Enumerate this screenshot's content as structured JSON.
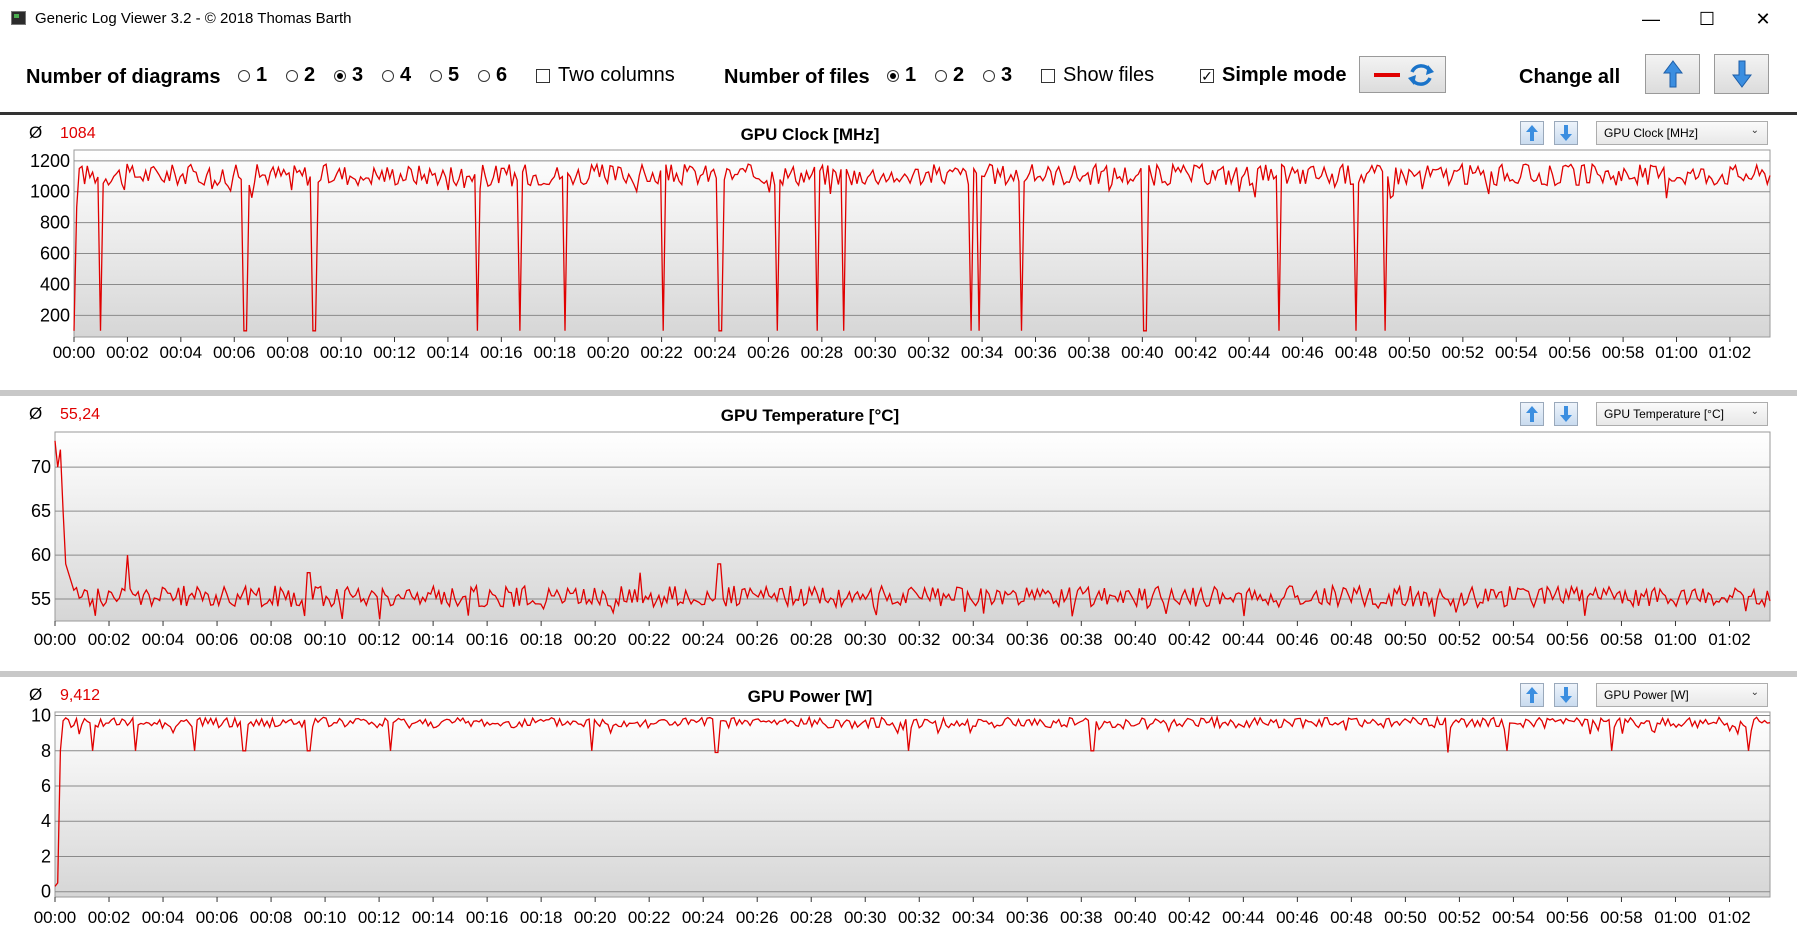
{
  "window": {
    "title": "Generic Log Viewer 3.2 - © 2018 Thomas Barth",
    "minimize": "—",
    "maximize": "☐",
    "close": "✕"
  },
  "toolbar": {
    "diagrams_label": "Number of diagrams",
    "diagram_options": [
      "1",
      "2",
      "3",
      "4",
      "5",
      "6"
    ],
    "diagrams_selected": "3",
    "two_columns_label": "Two columns",
    "two_columns_checked": false,
    "files_label": "Number of files",
    "file_options": [
      "1",
      "2",
      "3"
    ],
    "files_selected": "1",
    "show_files_label": "Show files",
    "show_files_checked": false,
    "simple_mode_label": "Simple mode",
    "simple_mode_checked": true,
    "change_all_label": "Change all",
    "line_color": "#e00000"
  },
  "charts": [
    {
      "avg_symbol": "Ø",
      "avg_value": "1084",
      "title": "GPU Clock [MHz]",
      "dropdown": "GPU Clock [MHz]",
      "ylim": [
        60,
        1270
      ],
      "yticks": [
        200,
        400,
        600,
        800,
        1000,
        1200
      ],
      "baseline": 1110,
      "noise": 70,
      "start_values": [
        100,
        900,
        1150
      ],
      "dips": [
        [
          1.0,
          100
        ],
        [
          6.4,
          100
        ],
        [
          9.0,
          100
        ],
        [
          15.1,
          100
        ],
        [
          16.7,
          100
        ],
        [
          18.4,
          100
        ],
        [
          22.1,
          100
        ],
        [
          24.2,
          100
        ],
        [
          26.3,
          100
        ],
        [
          27.8,
          100
        ],
        [
          28.8,
          100
        ],
        [
          33.6,
          100
        ],
        [
          33.9,
          100
        ],
        [
          35.5,
          100
        ],
        [
          40.1,
          100
        ],
        [
          45.1,
          100
        ],
        [
          48.0,
          100
        ],
        [
          49.1,
          100
        ]
      ],
      "x_ticks": [
        "00:00",
        "00:02",
        "00:04",
        "00:06",
        "00:08",
        "00:10",
        "00:12",
        "00:14",
        "00:16",
        "00:18",
        "00:20",
        "00:22",
        "00:24",
        "00:26",
        "00:28",
        "00:30",
        "00:32",
        "00:34",
        "00:36",
        "00:38",
        "00:40",
        "00:42",
        "00:44",
        "00:46",
        "00:48",
        "00:50",
        "00:52",
        "00:54",
        "00:56",
        "00:58",
        "01:00",
        "01:02"
      ]
    },
    {
      "avg_symbol": "Ø",
      "avg_value": "55,24",
      "title": "GPU Temperature [°C]",
      "dropdown": "GPU Temperature [°C]",
      "ylim": [
        52.5,
        74
      ],
      "yticks": [
        55,
        60,
        65,
        70
      ],
      "baseline": 55.3,
      "noise": 1.2,
      "start_values": [
        73,
        70,
        72,
        65,
        59,
        58,
        57,
        56
      ],
      "dips": [
        [
          2.7,
          60
        ],
        [
          9.4,
          58
        ],
        [
          21.7,
          58
        ],
        [
          24.6,
          59
        ]
      ],
      "x_ticks": [
        "00:00",
        "00:02",
        "00:04",
        "00:06",
        "00:08",
        "00:10",
        "00:12",
        "00:14",
        "00:16",
        "00:18",
        "00:20",
        "00:22",
        "00:24",
        "00:26",
        "00:28",
        "00:30",
        "00:32",
        "00:34",
        "00:36",
        "00:38",
        "00:40",
        "00:42",
        "00:44",
        "00:46",
        "00:48",
        "00:50",
        "00:52",
        "00:54",
        "00:56",
        "00:58",
        "01:00",
        "01:02"
      ]
    },
    {
      "avg_symbol": "Ø",
      "avg_value": "9,412",
      "title": "GPU Power [W]",
      "dropdown": "GPU Power [W]",
      "ylim": [
        -0.3,
        10.2
      ],
      "yticks": [
        0,
        2,
        4,
        6,
        8,
        10
      ],
      "baseline": 9.6,
      "noise": 0.3,
      "start_values": [
        0.3,
        0.5,
        8.0,
        9.7
      ],
      "dips": [
        [
          1.4,
          8.0
        ],
        [
          3.0,
          8.0
        ],
        [
          5.2,
          8.0
        ],
        [
          7.0,
          8.0
        ],
        [
          9.4,
          8.0
        ],
        [
          12.4,
          8.0
        ],
        [
          19.9,
          8.0
        ],
        [
          24.5,
          7.9
        ],
        [
          31.6,
          8.0
        ],
        [
          38.4,
          8.0
        ],
        [
          51.6,
          7.9
        ],
        [
          53.8,
          8.0
        ],
        [
          57.6,
          8.0
        ],
        [
          62.7,
          8.0
        ]
      ],
      "x_ticks": [
        "00:00",
        "00:02",
        "00:04",
        "00:06",
        "00:08",
        "00:10",
        "00:12",
        "00:14",
        "00:16",
        "00:18",
        "00:20",
        "00:22",
        "00:24",
        "00:26",
        "00:28",
        "00:30",
        "00:32",
        "00:34",
        "00:36",
        "00:38",
        "00:40",
        "00:42",
        "00:44",
        "00:46",
        "00:48",
        "00:50",
        "00:52",
        "00:54",
        "00:56",
        "00:58",
        "01:00",
        "01:02"
      ]
    }
  ],
  "chart_data": [
    {
      "type": "line",
      "title": "GPU Clock [MHz]",
      "ylim": [
        60,
        1270
      ],
      "xlim_minutes": [
        0,
        63.5
      ],
      "series": [
        {
          "values_summary": "~1050-1200 MHz with periodic drops to ~100 MHz"
        }
      ]
    },
    {
      "type": "line",
      "title": "GPU Temperature [°C]",
      "ylim": [
        52.5,
        74
      ],
      "xlim_minutes": [
        0,
        63.5
      ],
      "series": [
        {
          "values_summary": "starts ~73 °C, settles ~55 °C"
        }
      ]
    },
    {
      "type": "line",
      "title": "GPU Power [W]",
      "ylim": [
        -0.3,
        10.2
      ],
      "xlim_minutes": [
        0,
        63.5
      ],
      "series": [
        {
          "values_summary": "starts ~0.3 W, ~9.6 W with periodic dips to ~8 W"
        }
      ]
    }
  ]
}
